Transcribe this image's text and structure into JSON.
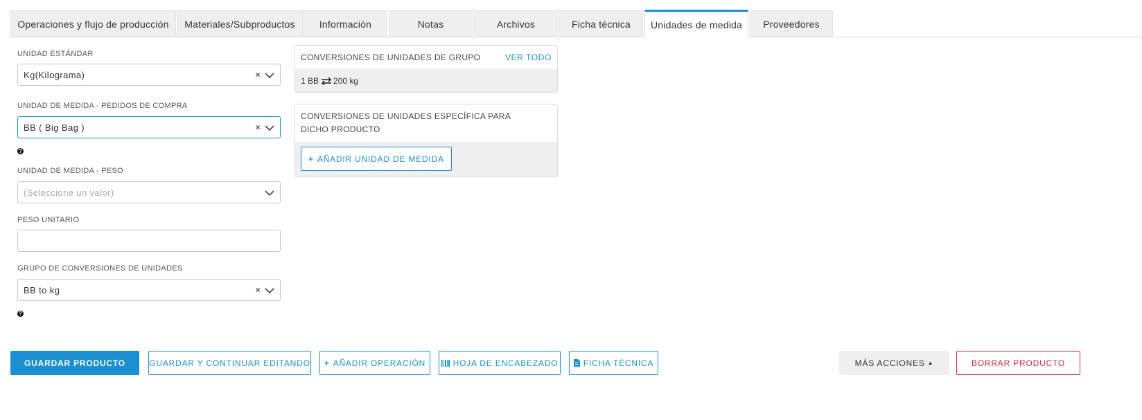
{
  "tabs": [
    {
      "label": "Operaciones y flujo de producción"
    },
    {
      "label": "Materiales/Subproductos"
    },
    {
      "label": "Información"
    },
    {
      "label": "Notas"
    },
    {
      "label": "Archivos"
    },
    {
      "label": "Ficha técnica"
    },
    {
      "label": "Unidades de medida"
    },
    {
      "label": "Proveedores"
    }
  ],
  "active_tab": "Unidades de medida",
  "form": {
    "standard_unit": {
      "label": "UNIDAD ESTÁNDAR",
      "value": "Kg(Kilograma)"
    },
    "purchase_unit": {
      "label": "UNIDAD DE MEDIDA - PEDIDOS DE COMPRA",
      "value": "BB ( Big Bag )"
    },
    "weight_unit": {
      "label": "UNIDAD DE MEDIDA - PESO",
      "placeholder": "(Seleccione un valor)"
    },
    "unit_weight": {
      "label": "PESO UNITARIO",
      "value": ""
    },
    "conversion_group": {
      "label": "GRUPO DE CONVERSIONES DE UNIDADES",
      "value": "BB to kg"
    }
  },
  "group_conversions": {
    "title": "CONVERSIONES DE UNIDADES DE GRUPO",
    "view_all": "VER TODO",
    "left": "1 BB",
    "right": "200 kg"
  },
  "specific_conversions": {
    "title": "CONVERSIONES DE UNIDADES ESPECÍFICA PARA DICHO PRODUCTO",
    "add_button": "AÑADIR UNIDAD DE MEDIDA"
  },
  "footer": {
    "save": "GUARDAR PRODUCTO",
    "save_continue": "GUARDAR Y CONTINUAR EDITANDO",
    "add_operation": "AÑADIR OPERACIÓN",
    "header_sheet": "HOJA DE ENCABEZADO",
    "tech_sheet": "FICHA TÉCNICA",
    "more_actions": "MÁS ACCIONES",
    "delete": "BORRAR PRODUCTO"
  },
  "colors": {
    "accent": "#1a8fd2",
    "danger": "#d7263d",
    "panel_bg": "#efefef"
  }
}
